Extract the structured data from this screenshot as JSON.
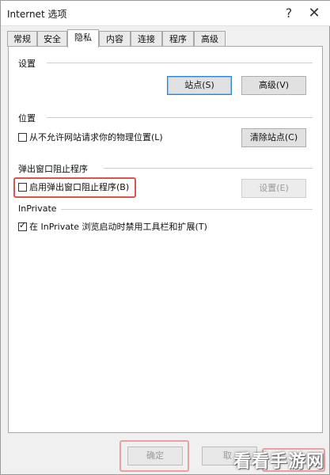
{
  "window": {
    "title": "Internet 选项",
    "help_label": "?",
    "close_label": "✕"
  },
  "tabs": [
    {
      "label": "常规"
    },
    {
      "label": "安全"
    },
    {
      "label": "隐私",
      "active": true
    },
    {
      "label": "内容"
    },
    {
      "label": "连接"
    },
    {
      "label": "程序"
    },
    {
      "label": "高级"
    }
  ],
  "settings": {
    "title": "设置",
    "sites_button": "站点(S)",
    "advanced_button": "高级(V)"
  },
  "location": {
    "title": "位置",
    "checkbox_label": "从不允许网站请求你的物理位置(L)",
    "checked": false,
    "clear_sites_button": "清除站点(C)"
  },
  "popup_blocker": {
    "title": "弹出窗口阻止程序",
    "checkbox_label": "启用弹出窗口阻止程序(B)",
    "checked": false,
    "settings_button": "设置(E)"
  },
  "inprivate": {
    "title": "InPrivate",
    "checkbox_label": "在 InPrivate 浏览启动时禁用工具栏和扩展(T)",
    "checked": true
  },
  "footer": {
    "ok_button": "确定",
    "cancel_button": "取"
  },
  "watermark": "看看手游网",
  "colors": {
    "highlight": "#d9534f",
    "focus_border": "#2b84d8"
  },
  "icons": {
    "check": "check-icon",
    "help": "help-icon",
    "close": "close-icon"
  }
}
